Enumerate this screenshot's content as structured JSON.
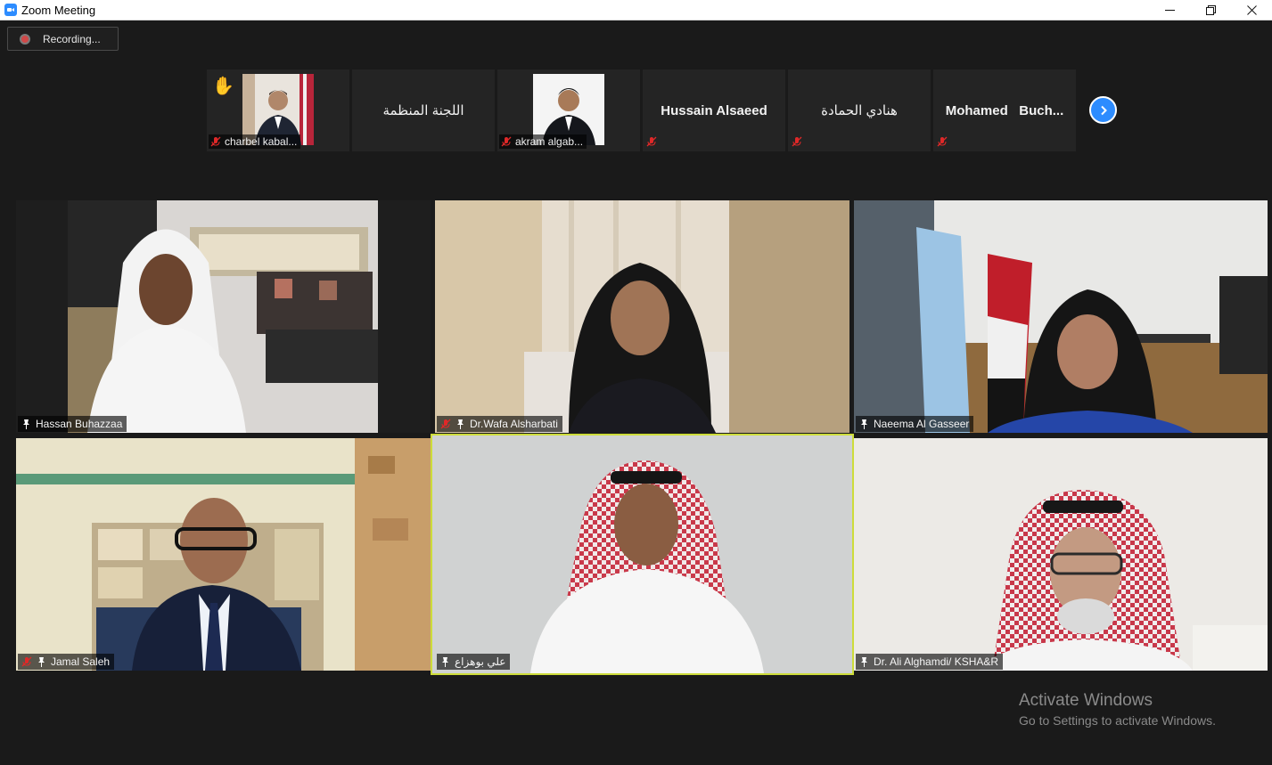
{
  "window": {
    "title": "Zoom Meeting"
  },
  "recording": {
    "label": "Recording..."
  },
  "filmstrip": [
    {
      "name": "charbel kabal...",
      "raised_hand": true,
      "has_video": true,
      "muted": true
    },
    {
      "name": "اللجنة المنظمة",
      "display_only": true,
      "muted": false
    },
    {
      "name": "akram algab...",
      "has_video": true,
      "muted": true
    },
    {
      "name": "Hussain Alsaeed",
      "display_only": true,
      "muted": true
    },
    {
      "name": "هنادي الحمادة",
      "display_only": true,
      "muted": true
    },
    {
      "name": "Mohamed   Buch...",
      "display_only": true,
      "muted": true
    }
  ],
  "tiles": [
    {
      "name": "Hassan Buhazzaa",
      "muted": false,
      "pinned": true
    },
    {
      "name": "Dr.Wafa Alsharbati",
      "muted": true,
      "pinned": true
    },
    {
      "name": "Naeema Al Gasseer",
      "muted": false,
      "pinned": true
    },
    {
      "name": "Jamal Saleh",
      "muted": true,
      "pinned": true
    },
    {
      "name": "علي بوهزاع",
      "muted": false,
      "pinned": true,
      "active_speaker": true
    },
    {
      "name": "Dr. Ali Alghamdi/ KSHA&R",
      "muted": false,
      "pinned": true
    }
  ],
  "watermark": {
    "title": "Activate Windows",
    "subtitle": "Go to Settings to activate Windows."
  },
  "colors": {
    "accent": "#2d8cff",
    "active_speaker": "#cddc3a",
    "mute_red": "#e02828",
    "background": "#1a1a1a"
  }
}
